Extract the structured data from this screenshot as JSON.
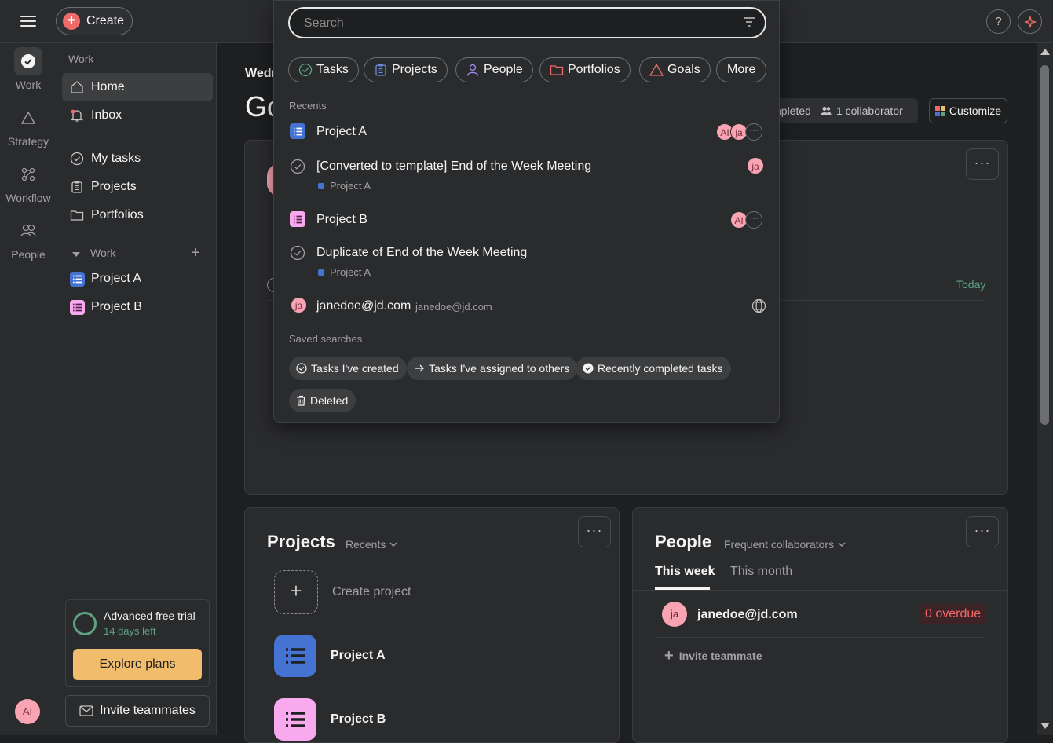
{
  "topbar": {
    "create_label": "Create",
    "help_label": "?"
  },
  "rail": {
    "items": [
      {
        "label": "Work"
      },
      {
        "label": "Strategy"
      },
      {
        "label": "Workflow"
      },
      {
        "label": "People"
      }
    ],
    "avatar": "AI"
  },
  "sidebar": {
    "section_title": "Work",
    "home": "Home",
    "inbox": "Inbox",
    "my_tasks": "My tasks",
    "projects": "Projects",
    "portfolios": "Portfolios",
    "work_group": "Work",
    "project_a": "Project A",
    "project_b": "Project B",
    "trial_title": "Advanced free trial",
    "trial_days": "14 days left",
    "explore_label": "Explore plans",
    "invite_label": "Invite teammates"
  },
  "main": {
    "date_fragment": "Wedn",
    "greeting_fragment": "Go",
    "stats_completed_fragment": "npleted",
    "stats_collaborators": "1 collaborator",
    "customize_label": "Customize",
    "task_due": "Today",
    "projects_card": {
      "title": "Projects",
      "filter": "Recents",
      "create_label": "Create project",
      "items": [
        "Project A",
        "Project B"
      ]
    },
    "people_card": {
      "title": "People",
      "filter": "Frequent collaborators",
      "tabs": [
        "This week",
        "This month"
      ],
      "person_avatar": "ja",
      "person_email": "janedoe@jd.com",
      "overdue": "0 overdue",
      "invite": "Invite teammate"
    }
  },
  "search": {
    "placeholder": "Search",
    "chips": [
      "Tasks",
      "Projects",
      "People",
      "Portfolios",
      "Goals",
      "More"
    ],
    "recents_label": "Recents",
    "recents": [
      {
        "title": "Project A",
        "avatars": [
          "AI",
          "ja"
        ]
      },
      {
        "title": "[Converted to template] End of the Week Meeting",
        "sub": "Project A",
        "avatars": [
          "ja"
        ]
      },
      {
        "title": "Project B",
        "avatars": [
          "AI"
        ]
      },
      {
        "title": "Duplicate of End of the Week Meeting",
        "sub": "Project A"
      },
      {
        "title": "janedoe@jd.com",
        "sub": "janedoe@jd.com",
        "avatar": "ja"
      }
    ],
    "saved_label": "Saved searches",
    "saved": [
      "Tasks I've created",
      "Tasks I've assigned to others",
      "Recently completed tasks",
      "Deleted"
    ]
  },
  "colors": {
    "accent": "#f06a6a",
    "project_a": "#4573d2",
    "project_b": "#f9aaef",
    "trial_green": "#5da283",
    "explore_button": "#f1bd6c"
  }
}
